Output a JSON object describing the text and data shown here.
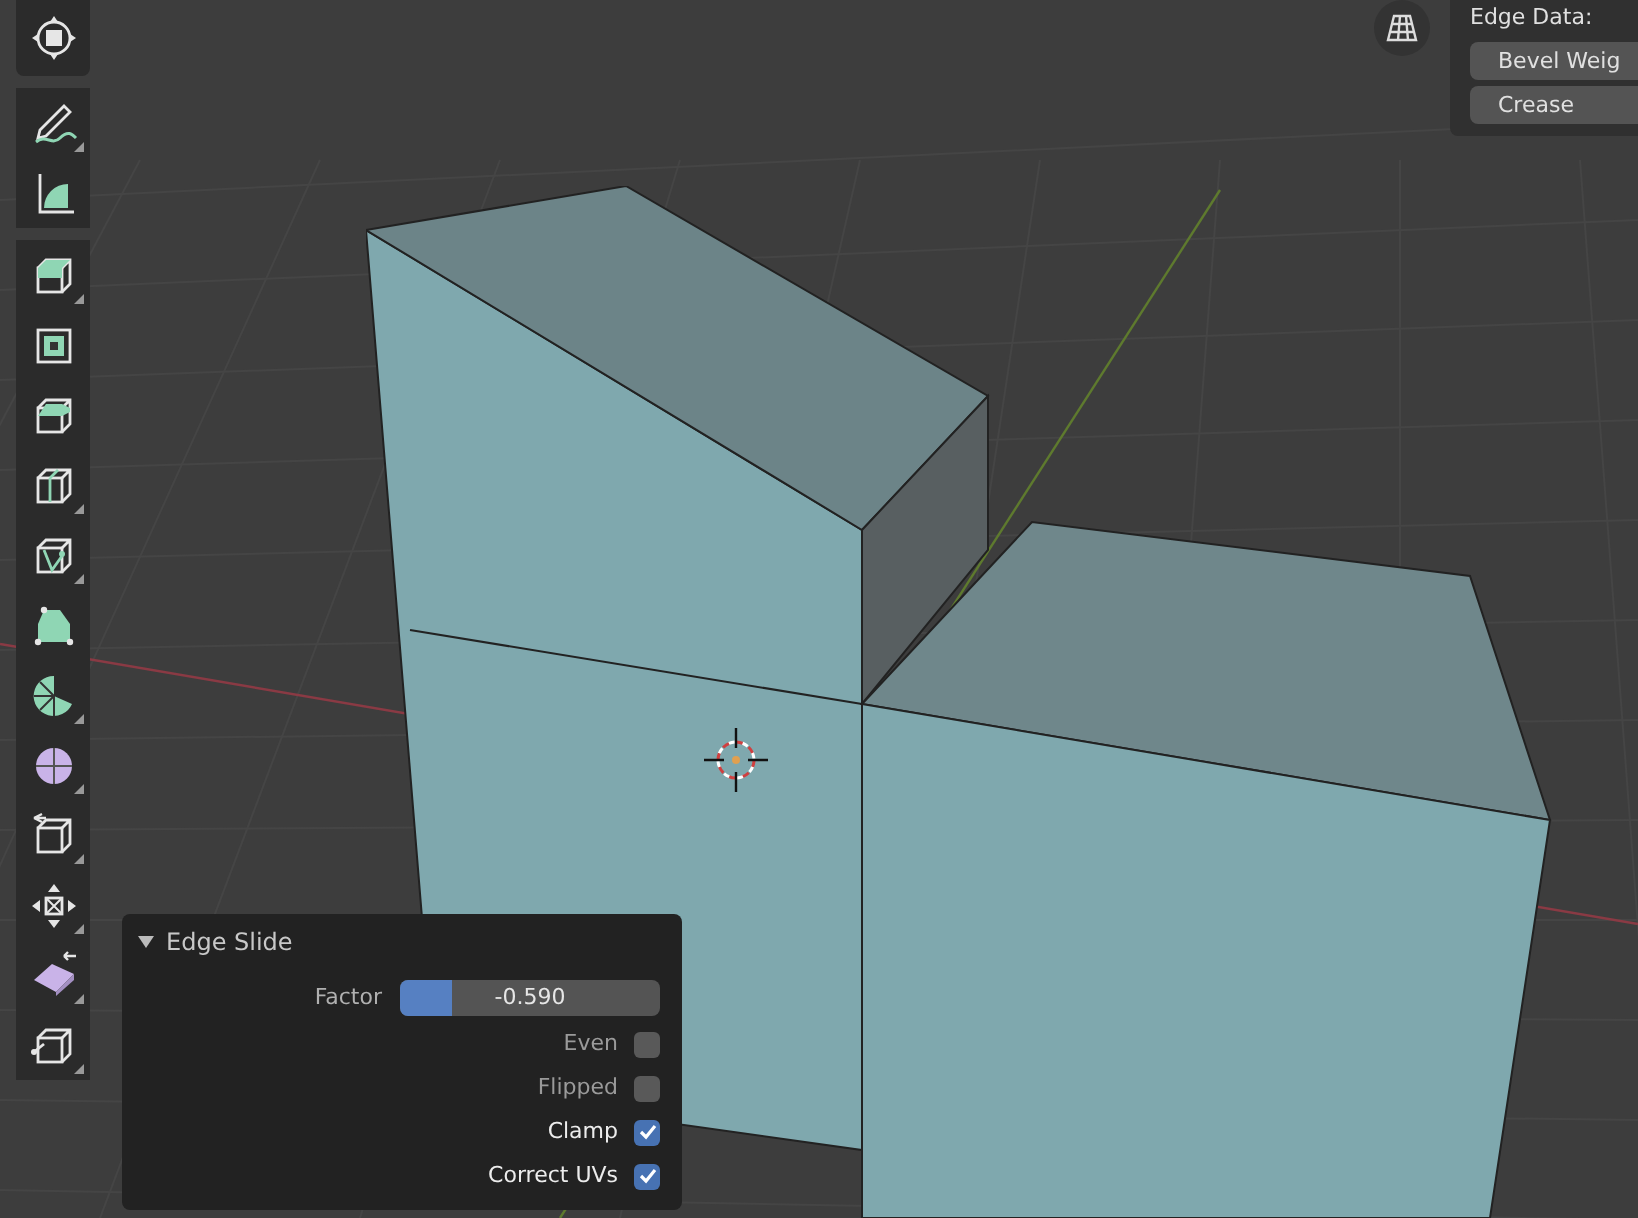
{
  "toolbar": {
    "tools": [
      {
        "kind": "cursor",
        "has_menu": false
      },
      {
        "kind": "annotate",
        "has_menu": true
      },
      {
        "kind": "measure",
        "has_menu": false
      },
      {
        "kind": "extrude",
        "has_menu": true
      },
      {
        "kind": "inset",
        "has_menu": false
      },
      {
        "kind": "bevel",
        "has_menu": false
      },
      {
        "kind": "loopcut",
        "has_menu": true
      },
      {
        "kind": "knife",
        "has_menu": true
      },
      {
        "kind": "polybuild",
        "has_menu": false
      },
      {
        "kind": "spin",
        "has_menu": true
      },
      {
        "kind": "smooth",
        "has_menu": true
      },
      {
        "kind": "shrink",
        "has_menu": true
      },
      {
        "kind": "move",
        "has_menu": true
      },
      {
        "kind": "shear",
        "has_menu": true
      },
      {
        "kind": "rip",
        "has_menu": true
      }
    ]
  },
  "edge_data": {
    "title": "Edge Data:",
    "fields": [
      {
        "label": "Bevel Weig"
      },
      {
        "label": "Crease"
      }
    ]
  },
  "operator_panel": {
    "title": "Edge Slide",
    "expanded": true,
    "factor": {
      "label": "Factor",
      "value": "-0.590",
      "level": 0.2
    },
    "options": [
      {
        "label": "Even",
        "checked": false
      },
      {
        "label": "Flipped",
        "checked": false
      },
      {
        "label": "Clamp",
        "checked": true
      },
      {
        "label": "Correct UVs",
        "checked": true
      }
    ]
  }
}
